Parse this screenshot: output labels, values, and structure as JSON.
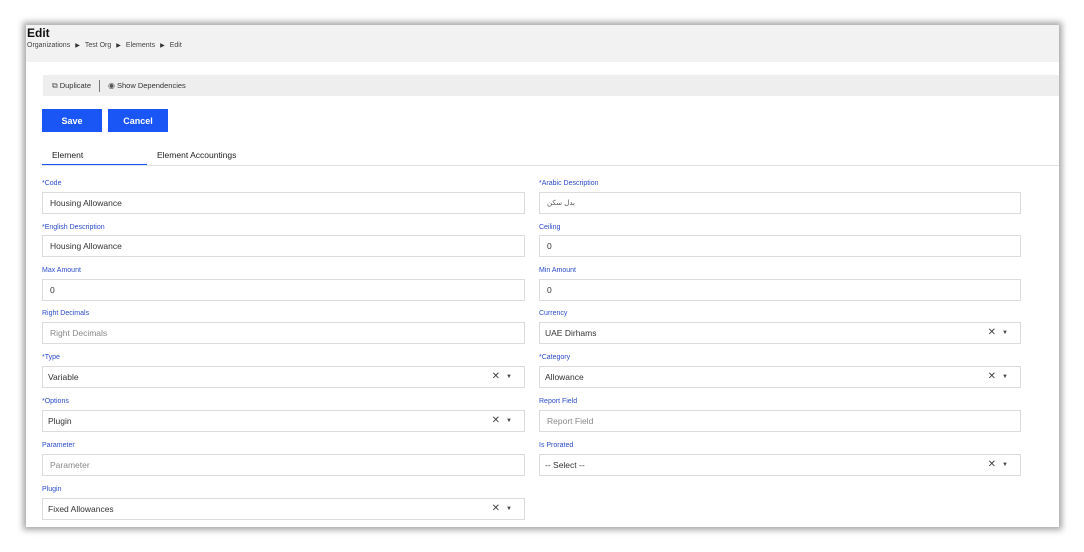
{
  "page": {
    "title": "Edit",
    "breadcrumb": [
      "Organizations",
      "Test Org",
      "Elements",
      "Edit"
    ]
  },
  "toolbar": {
    "duplicate_label": "Duplicate",
    "show_dependencies_label": "Show Dependencies"
  },
  "actions": {
    "save_label": "Save",
    "cancel_label": "Cancel"
  },
  "tabs": [
    {
      "label": "Element",
      "active": true
    },
    {
      "label": "Element Accountings",
      "active": false
    }
  ],
  "form": {
    "code": {
      "label": "*Code",
      "value": "Housing Allowance"
    },
    "arabic_description": {
      "label": "*Arabic Description",
      "value": "بدل سكن"
    },
    "english_description": {
      "label": "*English Description",
      "value": "Housing Allowance"
    },
    "ceiling": {
      "label": "Ceiling",
      "value": "0"
    },
    "max_amount": {
      "label": "Max Amount",
      "value": "0"
    },
    "min_amount": {
      "label": "Min Amount",
      "value": "0"
    },
    "right_decimals": {
      "label": "Right Decimals",
      "placeholder": "Right Decimals"
    },
    "currency": {
      "label": "Currency",
      "value": "UAE Dirhams"
    },
    "type": {
      "label": "*Type",
      "value": "Variable"
    },
    "category": {
      "label": "*Category",
      "value": "Allowance"
    },
    "options": {
      "label": "*Options",
      "value": "Plugin"
    },
    "report_field": {
      "label": "Report Field",
      "placeholder": "Report Field"
    },
    "parameter": {
      "label": "Parameter",
      "placeholder": "Parameter"
    },
    "is_prorated": {
      "label": "Is Prorated",
      "value": "-- Select --"
    },
    "plugin": {
      "label": "Plugin",
      "value": "Fixed Allowances"
    }
  },
  "icons": {
    "breadcrumb_separator": "chevron-right-icon",
    "duplicate": "copy-icon",
    "show_dependencies": "eye-icon",
    "clear": "close-icon",
    "dropdown": "caret-down-icon"
  },
  "colors": {
    "accent": "#1a56f5",
    "label": "#2b4cc9"
  }
}
